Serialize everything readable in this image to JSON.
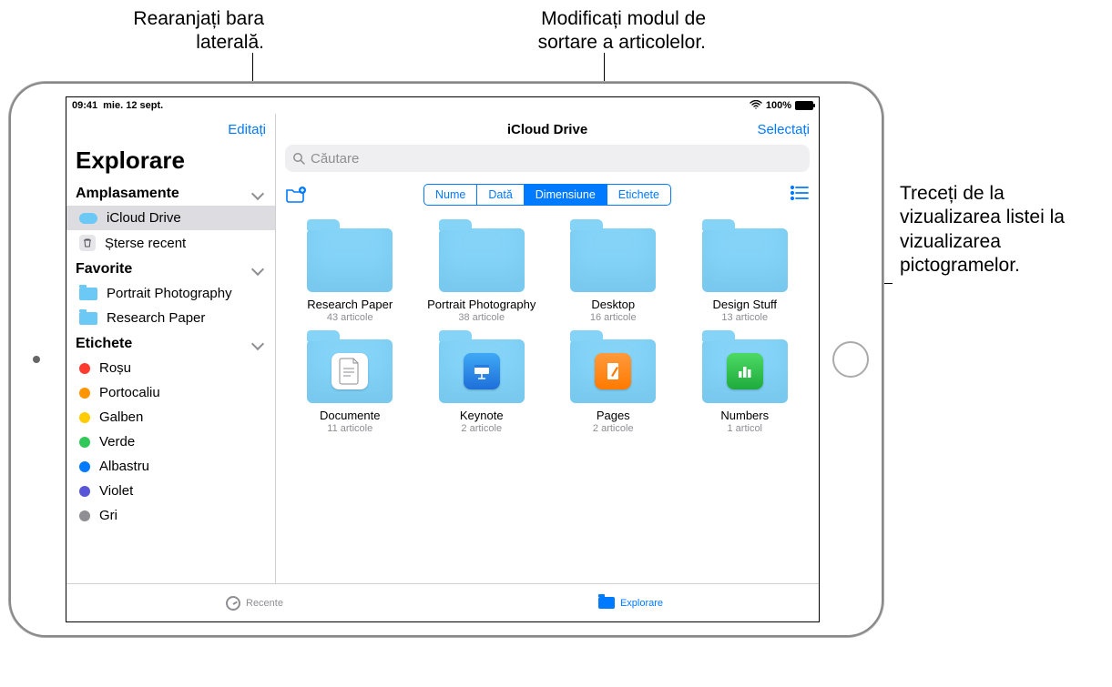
{
  "callouts": {
    "edit": "Rearanjați bara laterală.",
    "sort": "Modificați modul de sortare a articolelor.",
    "view": "Treceți de la vizualizarea listei la vizualizarea pictogramelor."
  },
  "status": {
    "time": "09:41",
    "date": "mie. 12 sept.",
    "battery_pct": "100%"
  },
  "sidebar": {
    "edit_button": "Editați",
    "title": "Explorare",
    "sections": {
      "locations_header": "Amplasamente",
      "favorites_header": "Favorite",
      "tags_header": "Etichete"
    },
    "locations": [
      {
        "label": "iCloud Drive",
        "selected": true
      },
      {
        "label": "Șterse recent",
        "selected": false
      }
    ],
    "favorites": [
      {
        "label": "Portrait Photography"
      },
      {
        "label": "Research Paper"
      }
    ],
    "tags": [
      {
        "label": "Roșu",
        "color": "#ff3b30"
      },
      {
        "label": "Portocaliu",
        "color": "#ff9500"
      },
      {
        "label": "Galben",
        "color": "#ffcc00"
      },
      {
        "label": "Verde",
        "color": "#34c759"
      },
      {
        "label": "Albastru",
        "color": "#007aff"
      },
      {
        "label": "Violet",
        "color": "#5856d6"
      },
      {
        "label": "Gri",
        "color": "#8e8e93"
      }
    ]
  },
  "content": {
    "title": "iCloud Drive",
    "select_button": "Selectați",
    "search_placeholder": "Căutare",
    "sort_options": {
      "name": "Nume",
      "date": "Dată",
      "size": "Dimensiune",
      "tags": "Etichete",
      "active": "size"
    },
    "folders": [
      {
        "name": "Research Paper",
        "sub": "43 articole",
        "thumb": ""
      },
      {
        "name": "Portrait Photography",
        "sub": "38 articole",
        "thumb": ""
      },
      {
        "name": "Desktop",
        "sub": "16 articole",
        "thumb": ""
      },
      {
        "name": "Design Stuff",
        "sub": "13 articole",
        "thumb": ""
      },
      {
        "name": "Documente",
        "sub": "11 articole",
        "thumb": "doc"
      },
      {
        "name": "Keynote",
        "sub": "2 articole",
        "thumb": "keynote"
      },
      {
        "name": "Pages",
        "sub": "2 articole",
        "thumb": "pages"
      },
      {
        "name": "Numbers",
        "sub": "1 articol",
        "thumb": "numbers"
      }
    ]
  },
  "tabbar": {
    "recents": "Recente",
    "browse": "Explorare"
  }
}
